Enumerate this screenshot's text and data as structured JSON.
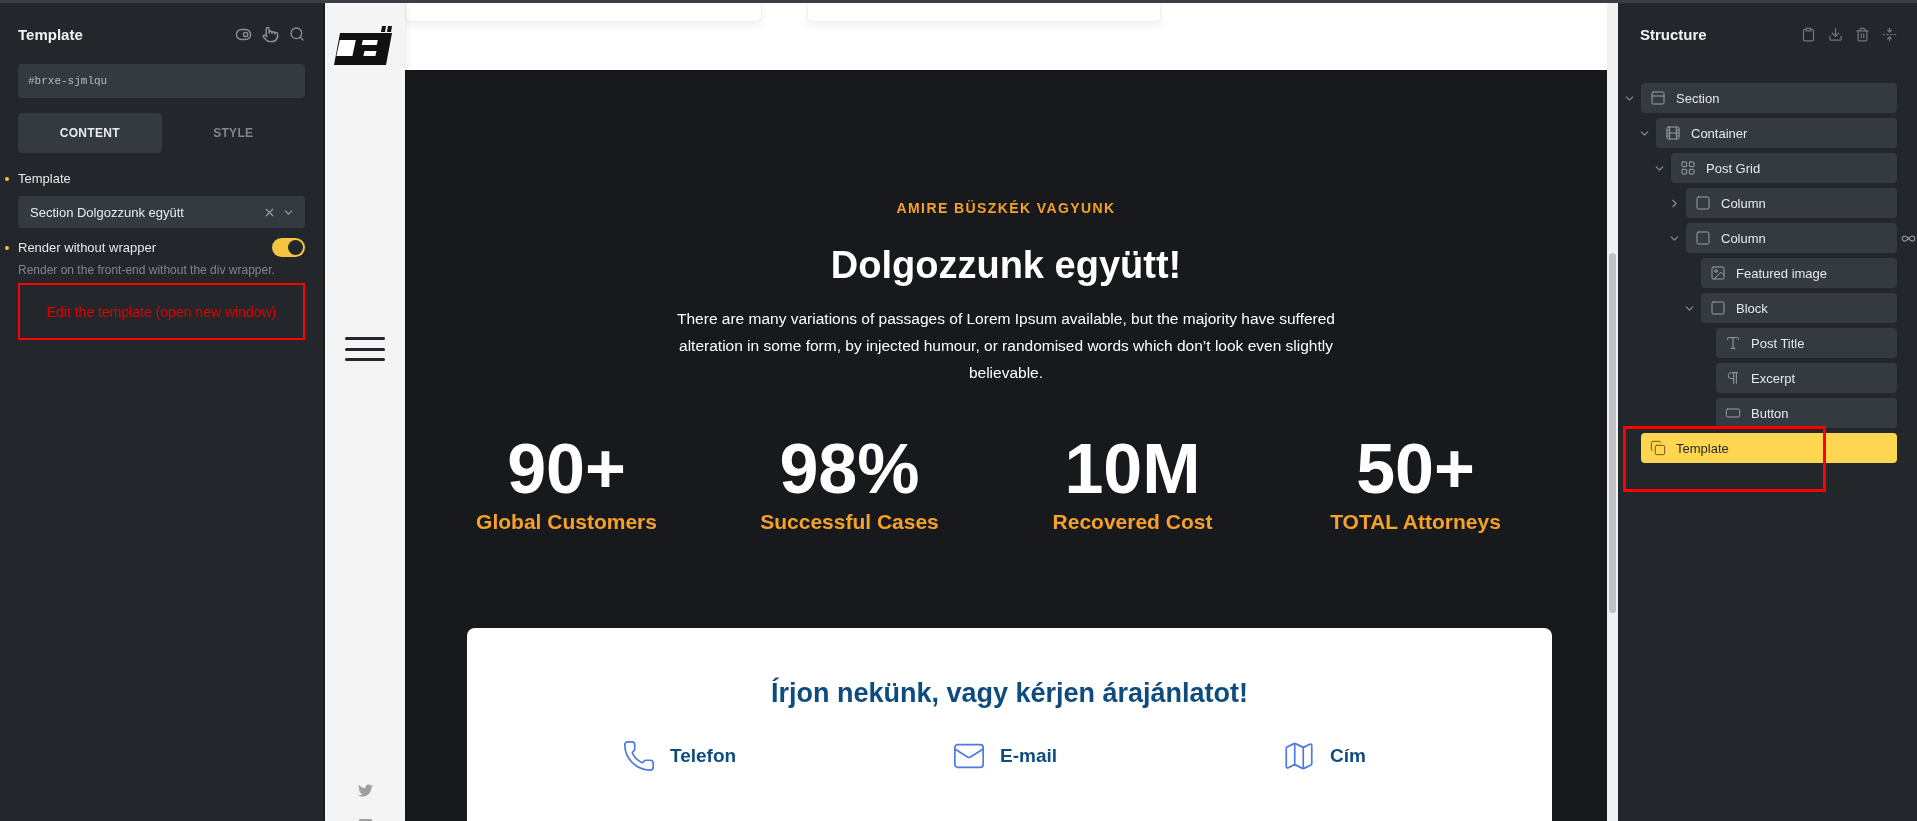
{
  "settings_panel": {
    "title": "Template",
    "element_id": "#brxe-sjmlqu",
    "tabs": [
      {
        "label": "CONTENT",
        "selected": true
      },
      {
        "label": "STYLE",
        "selected": false
      }
    ],
    "controls": [
      {
        "kind": "select",
        "label": "Template",
        "value": "Section Dolgozzunk együtt"
      },
      {
        "kind": "toggle",
        "label": "Render without wrapper",
        "on": true,
        "description": "Render on the front-end without the div wrapper."
      }
    ],
    "edit_link": "Edit the template (open new window)"
  },
  "canvas": {
    "eyebrow": "AMIRE BÜSZKÉK VAGYUNK",
    "heading": "Dolgozzunk együtt!",
    "paragraph": "There are many variations of passages of Lorem Ipsum available, but the majority have suffered alteration in some form, by injected humour, or randomised words which don’t look even slightly believable.",
    "stats": [
      {
        "value": "90+",
        "label": "Global Customers"
      },
      {
        "value": "98%",
        "label": "Successful Cases"
      },
      {
        "value": "10M",
        "label": "Recovered Cost"
      },
      {
        "value": "50+",
        "label": "TOTAL Attorneys"
      }
    ],
    "contact": {
      "heading": "Írjon nekünk, vagy kérjen árajánlatot!",
      "items": [
        {
          "kind": "phone",
          "label": "Telefon"
        },
        {
          "kind": "email",
          "label": "E-mail"
        },
        {
          "kind": "map",
          "label": "Cím"
        }
      ]
    }
  },
  "structure": {
    "title": "Structure",
    "tree": [
      {
        "label": "Section",
        "kind": "section",
        "expanded": true,
        "selected": false,
        "children": [
          {
            "label": "Container",
            "kind": "container",
            "expanded": true,
            "selected": false,
            "children": [
              {
                "label": "Post Grid",
                "kind": "grid",
                "expanded": true,
                "selected": false,
                "children": [
                  {
                    "label": "Column",
                    "kind": "block",
                    "expanded": false,
                    "selected": false
                  },
                  {
                    "label": "Column",
                    "kind": "block",
                    "expanded": true,
                    "selected": false,
                    "linked": true,
                    "children": [
                      {
                        "label": "Featured image",
                        "kind": "image",
                        "selected": false
                      },
                      {
                        "label": "Block",
                        "kind": "block",
                        "expanded": true,
                        "selected": false,
                        "children": [
                          {
                            "label": "Post Title",
                            "kind": "title",
                            "selected": false
                          },
                          {
                            "label": "Excerpt",
                            "kind": "excerpt",
                            "selected": false
                          },
                          {
                            "label": "Button",
                            "kind": "button",
                            "selected": false
                          }
                        ]
                      }
                    ]
                  }
                ]
              }
            ]
          }
        ]
      },
      {
        "label": "Template",
        "kind": "template",
        "selected": true
      }
    ]
  }
}
